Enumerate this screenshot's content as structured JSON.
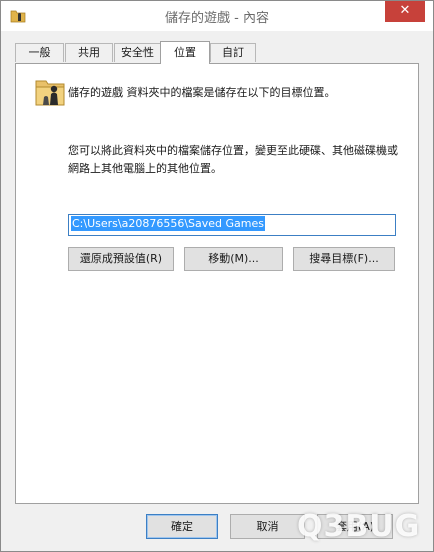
{
  "window": {
    "title": "儲存的遊戲 - 內容",
    "close_glyph": "✕"
  },
  "tabs": [
    {
      "label": "一般",
      "active": false
    },
    {
      "label": "共用",
      "active": false
    },
    {
      "label": "安全性",
      "active": false
    },
    {
      "label": "位置",
      "active": true
    },
    {
      "label": "自訂",
      "active": false
    }
  ],
  "location": {
    "description": "儲存的遊戲 資料夾中的檔案是儲存在以下的目標位置。",
    "instructions": "您可以將此資料夾中的檔案儲存位置，變更至此硬碟、其他磁碟機或網路上其他電腦上的其他位置。",
    "path_value": "C:\\Users\\a20876556\\Saved Games",
    "restore_label": "還原成預設值(R)",
    "move_label": "移動(M)...",
    "find_target_label": "搜尋目標(F)..."
  },
  "footer": {
    "ok_label": "確定",
    "cancel_label": "取消",
    "apply_label": "套用(A)"
  },
  "watermark": "Q3BUG",
  "icons": {
    "title": "folder-game-icon",
    "content": "folder-game-icon",
    "close": "close-icon"
  },
  "colors": {
    "selection": "#3399ff",
    "close_button": "#c7413a",
    "focus_border": "#3c7fc4"
  }
}
